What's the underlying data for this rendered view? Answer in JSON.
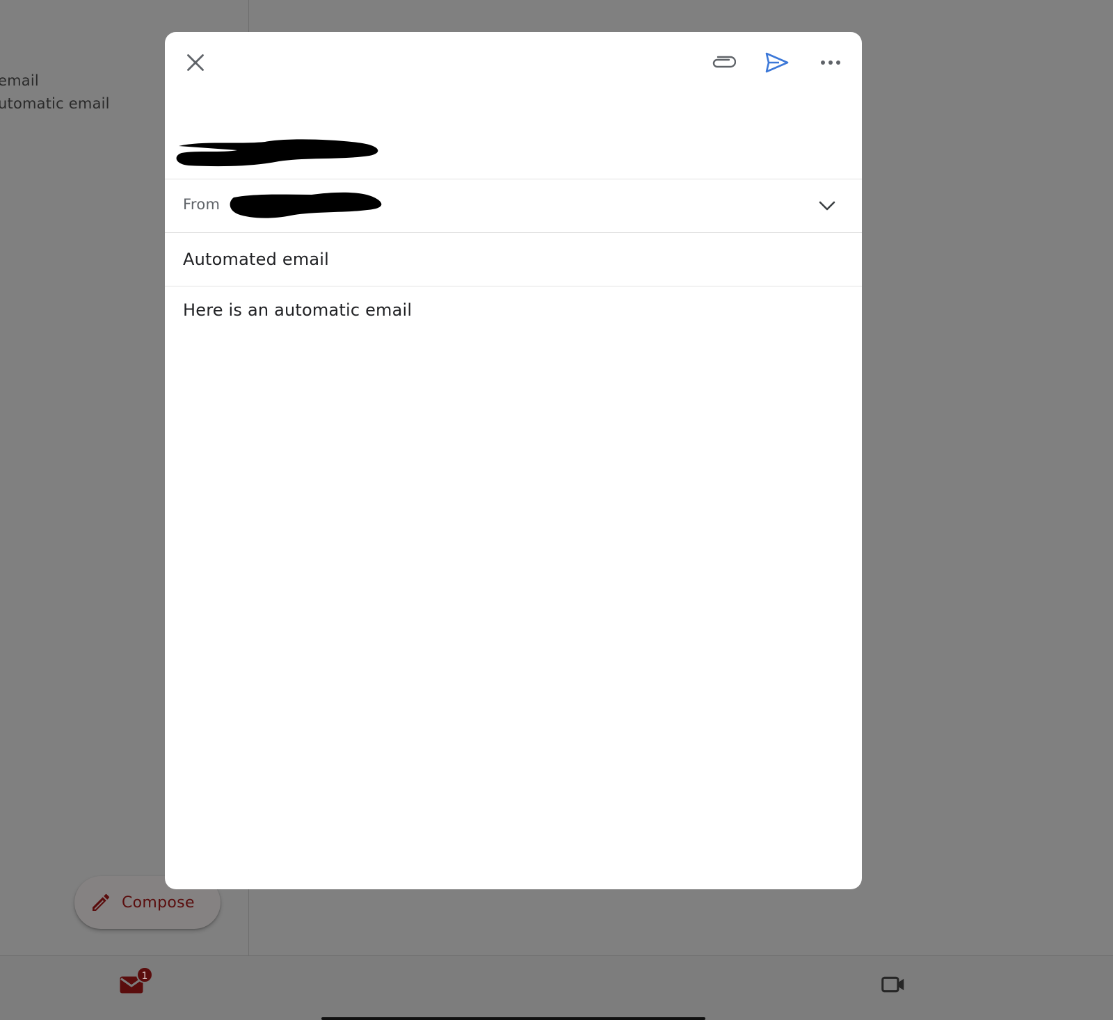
{
  "background": {
    "snippets": [
      "email",
      "utomatic email"
    ],
    "compose_button": {
      "label": "Compose"
    },
    "bottom_nav": {
      "mail_badge_count": "1"
    }
  },
  "compose": {
    "toolbar": {
      "close_icon": "close-icon",
      "attach_icon": "paperclip-icon",
      "send_icon": "send-icon",
      "more_icon": "more-horizontal-icon",
      "send_color": "#3c78d8"
    },
    "from_label": "From",
    "subject": "Automated email",
    "body": "Here is an automatic email"
  },
  "colors": {
    "overlay": "#808080",
    "accent_red": "#5a0d0d",
    "dialog_bg": "#ffffff"
  }
}
